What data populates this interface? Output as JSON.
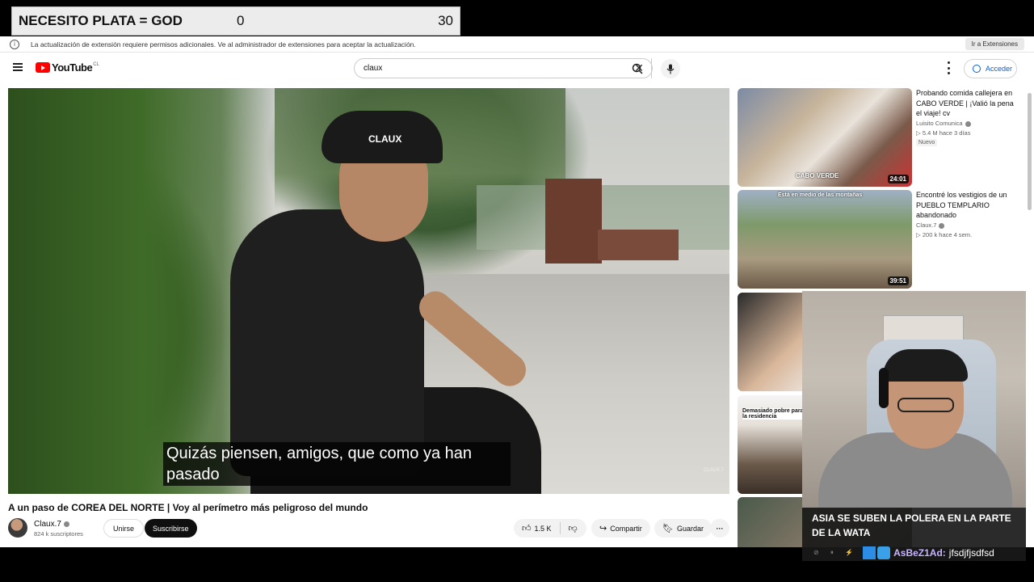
{
  "overlay": {
    "title": "NECESITO PLATA = GOD",
    "current": "0",
    "goal": "30"
  },
  "extension_bar": {
    "message": "La actualización de extensión requiere permisos adicionales. Ve al administrador de extensiones para aceptar la actualización.",
    "button": "Ir a Extensiones"
  },
  "masthead": {
    "logo_text": "YouTube",
    "country": "CL",
    "search_value": "claux",
    "signin_label": "Acceder"
  },
  "player": {
    "caption": "Quizás piensen, amigos, que como ya han pasado",
    "cap_text": "CLAUX",
    "watermark": "CLAUX.7"
  },
  "video": {
    "title": "A un paso de COREA DEL NORTE | Voy al perímetro más peligroso del mundo",
    "channel": "Claux.7",
    "subscribers": "824 k suscriptores",
    "join_label": "Unirse",
    "subscribe_label": "Suscribirse",
    "likes": "1.5 K",
    "share_label": "Compartir",
    "save_label": "Guardar"
  },
  "recommendations": [
    {
      "title": "Probando comida callejera en CABO VERDE | ¡Valió la pena el viaje! cv",
      "channel": "Luisito Comunica",
      "meta": "▷ 5.4 M  hace 3 días",
      "badge": "Nuevo",
      "duration": "24:01",
      "thumb_text": "CABO VERDE"
    },
    {
      "title": "Encontré los vestigios de un PUEBLO TEMPLARIO abandonado",
      "channel": "Claux.7",
      "meta": "▷ 200 k  hace 4 sem.",
      "duration": "39:51",
      "thumb_text": "Está en medio de las montañas"
    },
    {
      "thumb_text": ""
    },
    {
      "thumb_text": "Demasiado pobre para la residencia"
    }
  ],
  "stream": {
    "chat_title": "ASIA SE SUBEN LA POLERA EN LA PARTE DE LA WATA",
    "chat_user": "AsBeZ1Ad:",
    "chat_text": "jfsdjfjsdfsd"
  },
  "colors": {
    "brand_red": "#ff0000",
    "link_blue": "#065fd4",
    "chat_user": "#c7b3ff"
  }
}
